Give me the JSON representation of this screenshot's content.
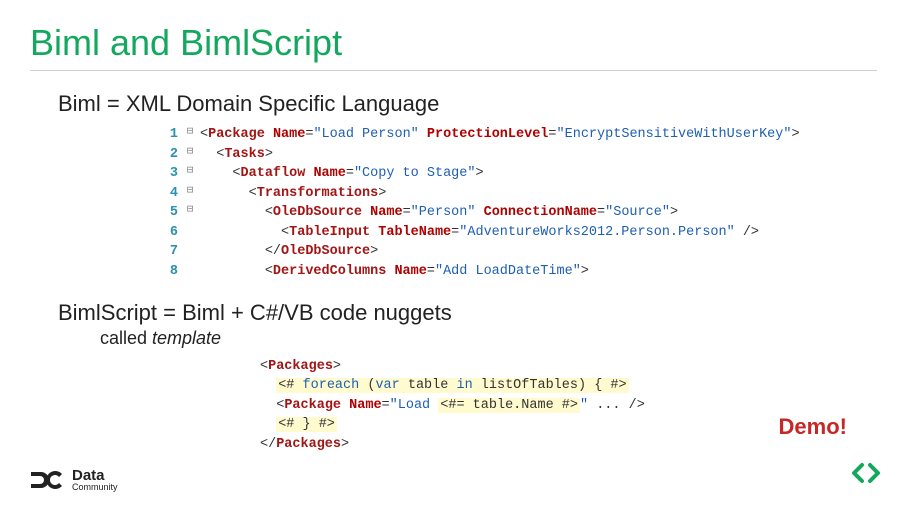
{
  "title": "Biml and BimlScript",
  "section1_heading": "Biml = XML Domain Specific Language",
  "code1": {
    "lines": [
      {
        "n": "1",
        "fold": "⊟",
        "indent": 0,
        "tokens": [
          {
            "t": "punct",
            "v": "<"
          },
          {
            "t": "tag",
            "v": "Package"
          },
          {
            "t": "plain",
            "v": " "
          },
          {
            "t": "attr",
            "v": "Name"
          },
          {
            "t": "punct",
            "v": "="
          },
          {
            "t": "str",
            "v": "\"Load Person\""
          },
          {
            "t": "plain",
            "v": " "
          },
          {
            "t": "attr",
            "v": "ProtectionLevel"
          },
          {
            "t": "punct",
            "v": "="
          },
          {
            "t": "str",
            "v": "\"EncryptSensitiveWithUserKey\""
          },
          {
            "t": "punct",
            "v": ">"
          }
        ]
      },
      {
        "n": "2",
        "fold": "⊟",
        "indent": 1,
        "tokens": [
          {
            "t": "punct",
            "v": "<"
          },
          {
            "t": "tag",
            "v": "Tasks"
          },
          {
            "t": "punct",
            "v": ">"
          }
        ]
      },
      {
        "n": "3",
        "fold": "⊟",
        "indent": 2,
        "tokens": [
          {
            "t": "punct",
            "v": "<"
          },
          {
            "t": "tag",
            "v": "Dataflow"
          },
          {
            "t": "plain",
            "v": " "
          },
          {
            "t": "attr",
            "v": "Name"
          },
          {
            "t": "punct",
            "v": "="
          },
          {
            "t": "str",
            "v": "\"Copy to Stage\""
          },
          {
            "t": "punct",
            "v": ">"
          }
        ]
      },
      {
        "n": "4",
        "fold": "⊟",
        "indent": 3,
        "tokens": [
          {
            "t": "punct",
            "v": "<"
          },
          {
            "t": "tag",
            "v": "Transformations"
          },
          {
            "t": "punct",
            "v": ">"
          }
        ]
      },
      {
        "n": "5",
        "fold": "⊟",
        "indent": 4,
        "tokens": [
          {
            "t": "punct",
            "v": "<"
          },
          {
            "t": "tag",
            "v": "OleDbSource"
          },
          {
            "t": "plain",
            "v": " "
          },
          {
            "t": "attr",
            "v": "Name"
          },
          {
            "t": "punct",
            "v": "="
          },
          {
            "t": "str",
            "v": "\"Person\""
          },
          {
            "t": "plain",
            "v": " "
          },
          {
            "t": "attr",
            "v": "ConnectionName"
          },
          {
            "t": "punct",
            "v": "="
          },
          {
            "t": "str",
            "v": "\"Source\""
          },
          {
            "t": "punct",
            "v": ">"
          }
        ]
      },
      {
        "n": "6",
        "fold": "",
        "indent": 5,
        "tokens": [
          {
            "t": "punct",
            "v": "<"
          },
          {
            "t": "tag",
            "v": "TableInput"
          },
          {
            "t": "plain",
            "v": " "
          },
          {
            "t": "attr",
            "v": "TableName"
          },
          {
            "t": "punct",
            "v": "="
          },
          {
            "t": "str",
            "v": "\"AdventureWorks2012.Person.Person\""
          },
          {
            "t": "punct",
            "v": " />"
          }
        ]
      },
      {
        "n": "7",
        "fold": "",
        "indent": 4,
        "tokens": [
          {
            "t": "punct",
            "v": "</"
          },
          {
            "t": "tag",
            "v": "OleDbSource"
          },
          {
            "t": "punct",
            "v": ">"
          }
        ]
      },
      {
        "n": "8",
        "fold": "",
        "indent": 4,
        "tokens": [
          {
            "t": "punct",
            "v": "<"
          },
          {
            "t": "tag",
            "v": "DerivedColumns"
          },
          {
            "t": "plain",
            "v": " "
          },
          {
            "t": "attr",
            "v": "Name"
          },
          {
            "t": "punct",
            "v": "="
          },
          {
            "t": "str",
            "v": "\"Add LoadDateTime\""
          },
          {
            "t": "punct",
            "v": ">"
          }
        ]
      }
    ]
  },
  "section2_heading": "BimlScript = Biml + C#/VB code nuggets",
  "section2_note_prefix": "called ",
  "section2_note_italic": "template",
  "code2": {
    "lines": [
      {
        "indent": 0,
        "tokens": [
          {
            "t": "punct",
            "v": "<"
          },
          {
            "t": "tag",
            "v": "Packages"
          },
          {
            "t": "punct",
            "v": ">"
          }
        ]
      },
      {
        "indent": 1,
        "tokens": [
          {
            "t": "nugget",
            "parts": [
              {
                "t": "punct",
                "v": "<# "
              },
              {
                "t": "kw",
                "v": "foreach"
              },
              {
                "t": "plain",
                "v": " ("
              },
              {
                "t": "kw",
                "v": "var"
              },
              {
                "t": "plain",
                "v": " table "
              },
              {
                "t": "kw",
                "v": "in"
              },
              {
                "t": "plain",
                "v": " listOfTables) { #>"
              }
            ]
          }
        ]
      },
      {
        "indent": 1,
        "tokens": [
          {
            "t": "punct",
            "v": "<"
          },
          {
            "t": "tag",
            "v": "Package"
          },
          {
            "t": "plain",
            "v": " "
          },
          {
            "t": "attr",
            "v": "Name"
          },
          {
            "t": "punct",
            "v": "="
          },
          {
            "t": "str",
            "v": "\"Load "
          },
          {
            "t": "nugget",
            "parts": [
              {
                "t": "punct",
                "v": "<#= "
              },
              {
                "t": "plain",
                "v": "table.Name "
              },
              {
                "t": "punct",
                "v": "#>"
              }
            ]
          },
          {
            "t": "str",
            "v": "\""
          },
          {
            "t": "plain",
            "v": " ... "
          },
          {
            "t": "punct",
            "v": "/>"
          }
        ]
      },
      {
        "indent": 1,
        "tokens": [
          {
            "t": "nugget",
            "parts": [
              {
                "t": "punct",
                "v": "<# } #>"
              }
            ]
          }
        ]
      },
      {
        "indent": 0,
        "tokens": [
          {
            "t": "punct",
            "v": "</"
          },
          {
            "t": "tag",
            "v": "Packages"
          },
          {
            "t": "punct",
            "v": ">"
          }
        ]
      }
    ]
  },
  "demo_label": "Demo!",
  "footer": {
    "brand_top": "Data",
    "brand_bottom": "Community"
  }
}
